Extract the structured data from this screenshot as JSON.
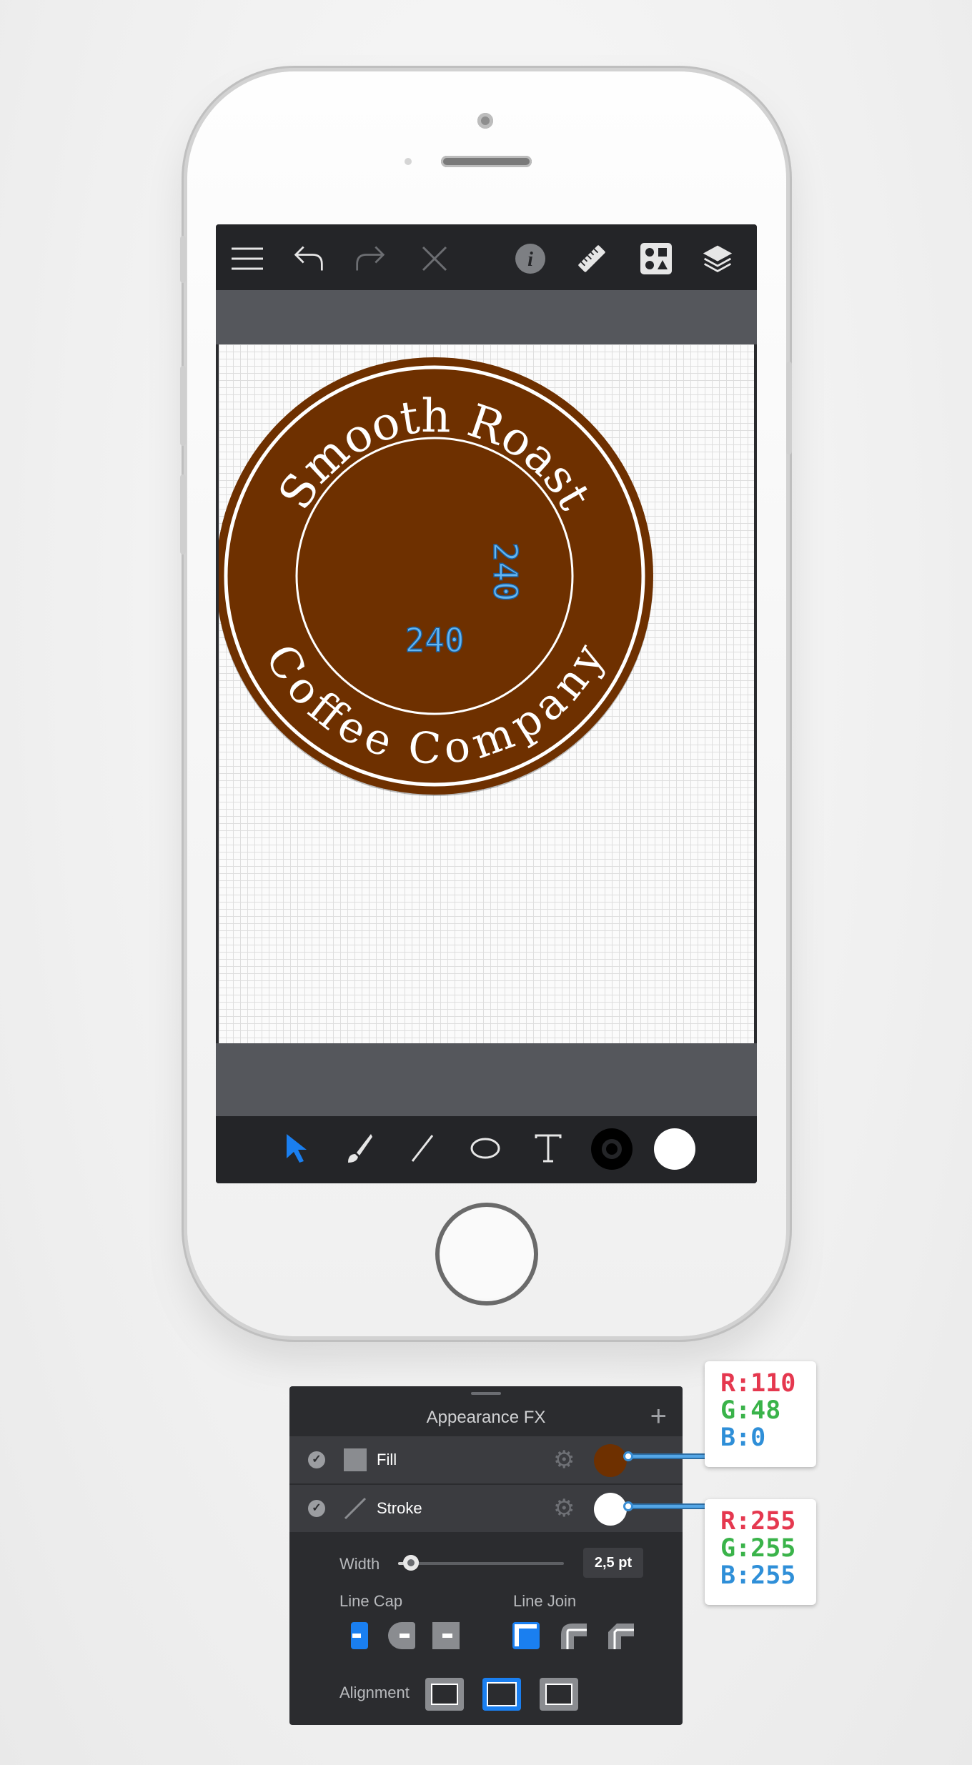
{
  "toolbar_top": {
    "icons": [
      "menu-icon",
      "undo-icon",
      "redo-icon",
      "close-icon",
      "info-icon",
      "ruler-icon",
      "symbols-icon",
      "layers-icon"
    ]
  },
  "badge": {
    "top_text": "Smooth Roast",
    "bottom_text": "Coffee Company",
    "fill_color": "#6e3000",
    "stroke_color": "#ffffff"
  },
  "measurements": {
    "horizontal": "240",
    "vertical": "240"
  },
  "tools": [
    "select-icon",
    "brush-icon",
    "line-icon",
    "ellipse-icon",
    "text-icon",
    "stroke-color-icon",
    "fill-color-icon"
  ],
  "panel": {
    "title": "Appearance FX",
    "plus": "+",
    "fill_label": "Fill",
    "stroke_label": "Stroke",
    "width_label": "Width",
    "width_value": "2,5 pt",
    "width_fraction": 0.06,
    "line_cap_label": "Line Cap",
    "line_join_label": "Line Join",
    "alignment_label": "Alignment",
    "fill_color": "#6e3000",
    "stroke_color": "#ffffff"
  },
  "callouts": {
    "fill": {
      "r": "R:110",
      "g": "G:48",
      "b": "B:0"
    },
    "stroke": {
      "r": "R:255",
      "g": "G:255",
      "b": "B:255"
    }
  }
}
